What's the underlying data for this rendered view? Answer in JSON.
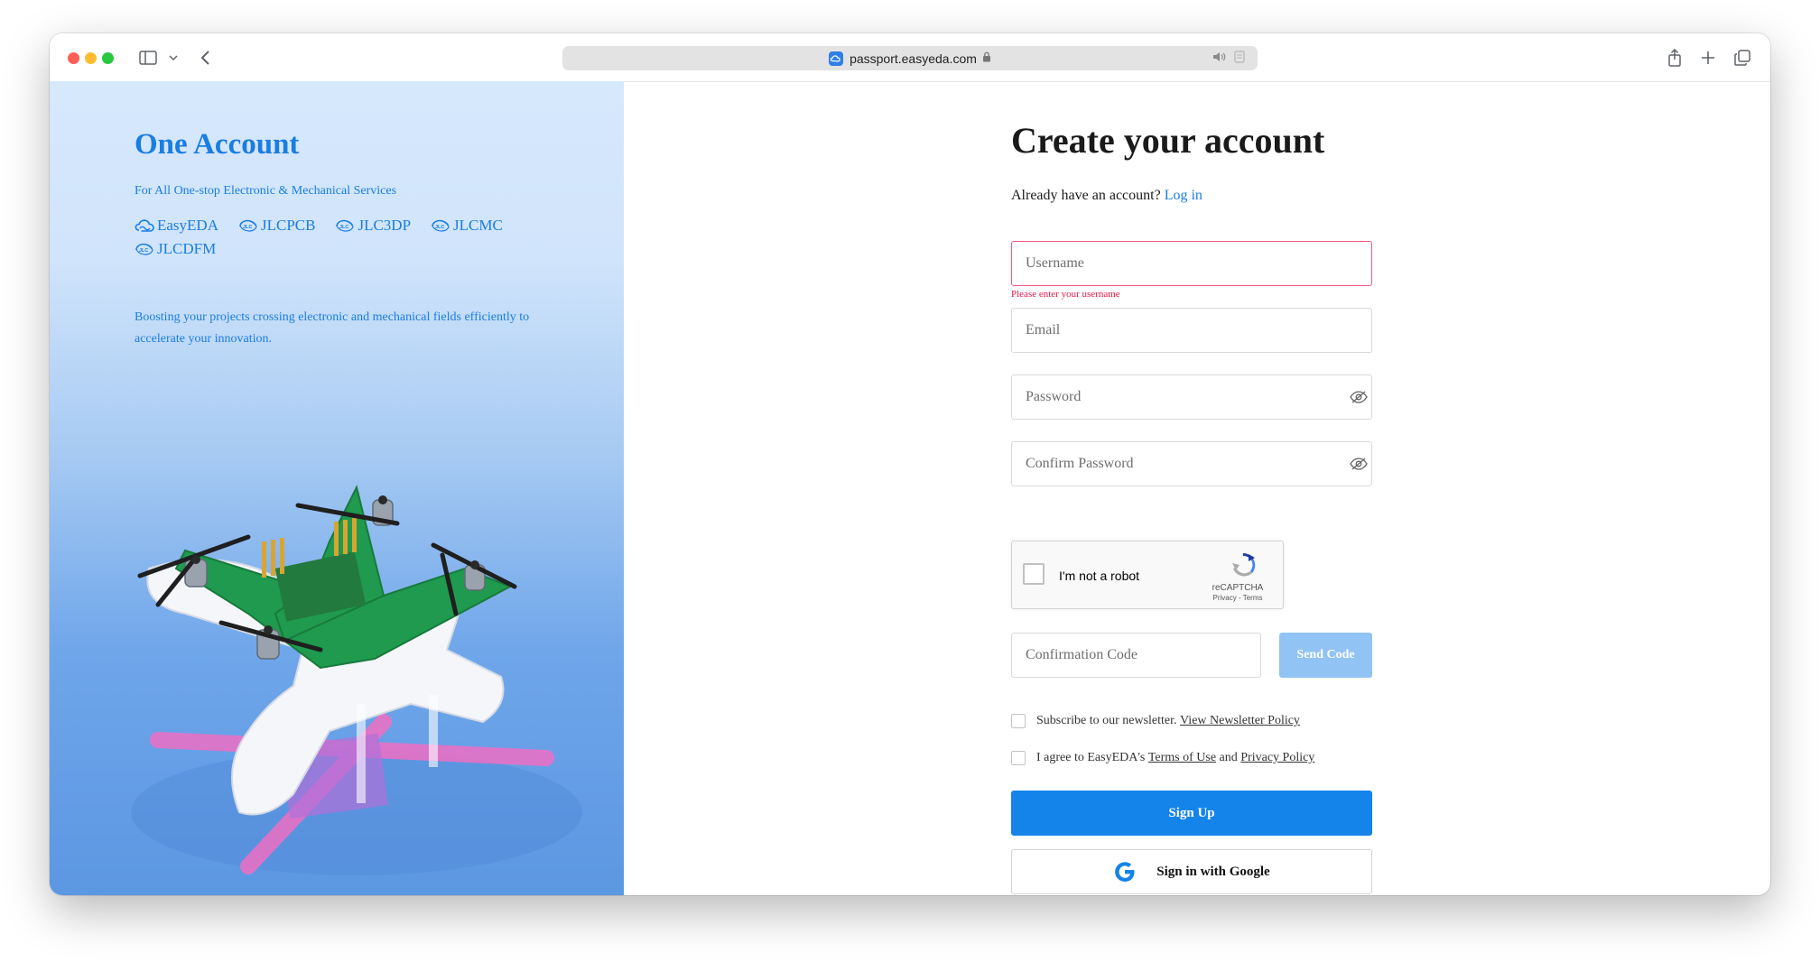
{
  "browser": {
    "url": "passport.easyeda.com"
  },
  "promo": {
    "title": "One Account",
    "subtitle": "For All One-stop Electronic & Mechanical Services",
    "brands": [
      "EasyEDA",
      "JLCPCB",
      "JLC3DP",
      "JLCMC",
      "JLCDFM"
    ],
    "description": "Boosting your projects crossing electronic and mechanical fields efficiently to accelerate your innovation.",
    "accent_color": "#1a7de3"
  },
  "form": {
    "title": "Create your account",
    "have_account": "Already have an account?",
    "login_link": "Log in",
    "username": {
      "placeholder": "Username",
      "value": "",
      "error": "Please enter your username"
    },
    "email": {
      "placeholder": "Email",
      "value": ""
    },
    "password": {
      "placeholder": "Password",
      "value": ""
    },
    "confirm_password": {
      "placeholder": "Confirm Password",
      "value": ""
    },
    "recaptcha": {
      "label": "I'm not a robot",
      "brand": "reCAPTCHA",
      "terms": "Privacy - Terms",
      "checked": false
    },
    "confirmation_code": {
      "placeholder": "Confirmation Code",
      "value": ""
    },
    "send_code_label": "Send Code",
    "newsletter": {
      "text": "Subscribe to our newsletter.",
      "link": "View Newsletter Policy",
      "checked": false
    },
    "agree": {
      "prefix": "I agree to EasyEDA's",
      "terms_link": "Terms of Use",
      "and": "and",
      "privacy_link": "Privacy Policy",
      "checked": false
    },
    "signup_label": "Sign Up",
    "google_label": "Sign in with Google",
    "primary_color": "#1483ea",
    "error_color": "#e6184a"
  }
}
